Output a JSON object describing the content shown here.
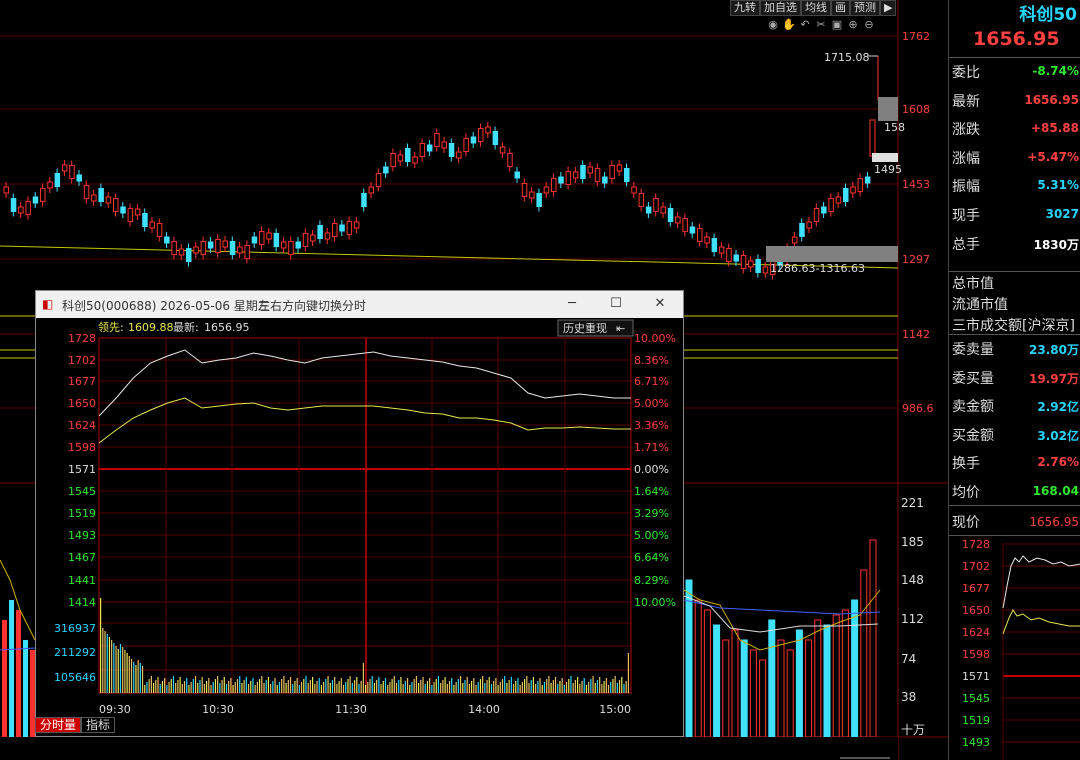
{
  "toolbar": {
    "items": [
      "九转",
      "加自选",
      "均线",
      "画",
      "预测"
    ],
    "arrow": "▶"
  },
  "icons": [
    "eye-icon",
    "hand-icon",
    "undo-icon",
    "scissors-icon",
    "lock-icon",
    "zoom-in-icon",
    "zoom-out-icon"
  ],
  "main": {
    "price_axis": [
      "1762",
      "1608",
      "1453",
      "1297",
      "1142",
      "986.6"
    ],
    "volume_axis": [
      "221",
      "185",
      "148",
      "112",
      "74",
      "38",
      "十万"
    ],
    "annot_high": "1715.08",
    "annot_158": "158",
    "annot_1495": "1495",
    "annot_range": "1286.63-1316.63"
  },
  "popup": {
    "title": "科创50(000688) 2026-05-06 星期三",
    "hint": "左右方向键切换分时",
    "lead_label": "领先:",
    "lead_value": "1609.88",
    "latest_label": "最新:",
    "latest_value": "1656.95",
    "history_btn": "历史重现",
    "price_ticks": [
      "1728",
      "1702",
      "1677",
      "1650",
      "1624",
      "1598",
      "1571",
      "1545",
      "1519",
      "1493",
      "1467",
      "1441",
      "1414"
    ],
    "pct_ticks": [
      "10.00%",
      "8.36%",
      "6.71%",
      "5.00%",
      "3.36%",
      "1.71%",
      "0.00%",
      "1.64%",
      "3.29%",
      "5.00%",
      "6.64%",
      "8.29%",
      "10.00%"
    ],
    "vol_ticks": [
      "316937",
      "211292",
      "105646"
    ],
    "time_ticks": [
      "09:30",
      "10:30",
      "11:30",
      "14:00",
      "15:00"
    ]
  },
  "tabs": {
    "fenshi": "分时量",
    "zhibiao": "指标"
  },
  "panel": {
    "name": "科创50",
    "price": "1656.95",
    "rows": [
      {
        "label": "委比",
        "value": "-8.74%",
        "color": "#2ee82e"
      },
      {
        "label": "最新",
        "value": "1656.95",
        "color": "#ff4040"
      },
      {
        "label": "涨跌",
        "value": "+85.88",
        "color": "#ff4040"
      },
      {
        "label": "涨幅",
        "value": "+5.47%",
        "color": "#ff4040"
      },
      {
        "label": "振幅",
        "value": "5.31%",
        "color": "#27d5ff"
      },
      {
        "label": "现手",
        "value": "3027",
        "color": "#27d5ff"
      },
      {
        "label": "总手",
        "value": "1830万",
        "color": "#ffffff"
      }
    ],
    "rows2": [
      {
        "label": "总市值",
        "value": ""
      },
      {
        "label": "流通市值",
        "value": ""
      },
      {
        "label": "三市成交额[沪深京]",
        "value": ""
      }
    ],
    "rows3": [
      {
        "label": "委卖量",
        "value": "23.80万",
        "color": "#27d5ff"
      },
      {
        "label": "委买量",
        "value": "19.97万",
        "color": "#ff4040"
      },
      {
        "label": "卖金额",
        "value": "2.92亿",
        "color": "#27d5ff"
      },
      {
        "label": "买金额",
        "value": "3.02亿",
        "color": "#27d5ff"
      },
      {
        "label": "换手",
        "value": "2.76%",
        "color": "#ff4040"
      },
      {
        "label": "均价",
        "value": "168.04",
        "color": "#2ee82e"
      }
    ],
    "xianjia_label": "现价",
    "xianjia_value": "1656.95",
    "mini_ticks": [
      "1728",
      "1702",
      "1677",
      "1650",
      "1624",
      "1598",
      "1571",
      "1545",
      "1519",
      "1493"
    ]
  }
}
